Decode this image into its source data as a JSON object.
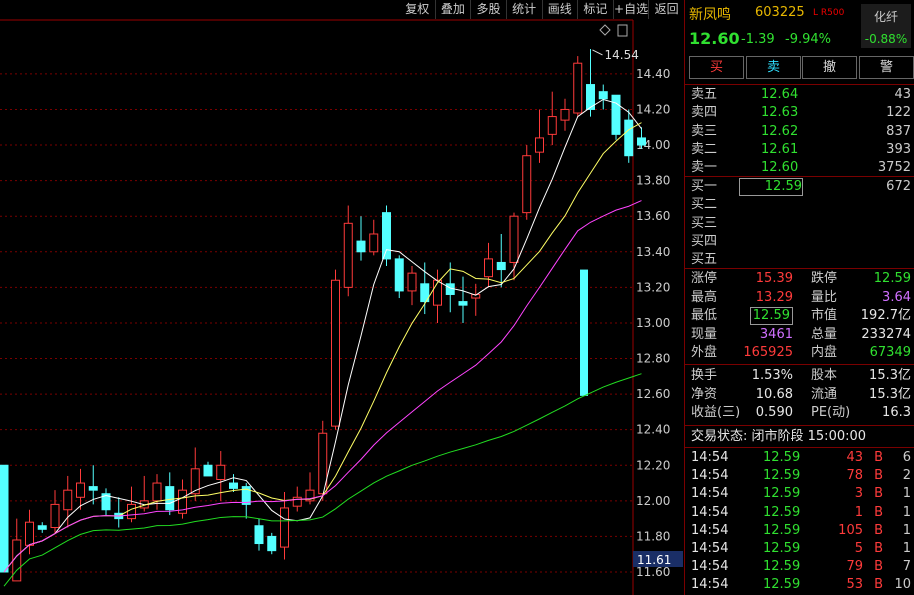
{
  "toolbar": [
    "复权",
    "叠加",
    "多股",
    "统计",
    "画线",
    "标记",
    "+自选",
    "返回"
  ],
  "chart": {
    "ylabels": [
      "14.40",
      "14.20",
      "14.00",
      "13.80",
      "13.60",
      "13.40",
      "13.20",
      "13.00",
      "12.80",
      "12.60",
      "12.40",
      "12.20",
      "12.00",
      "11.80",
      "11.60"
    ],
    "current_price_tag": "11.61",
    "high_label": "14.54",
    "colors": {
      "up": "#ff3b3b",
      "down": "#54ffff",
      "ma5": "#ffffff",
      "ma10": "#ffff66",
      "ma20": "#ff44ff",
      "ma60": "#22dd22",
      "grid": "#7a0000"
    }
  },
  "chart_data": {
    "type": "candlestick",
    "ylim": [
      11.55,
      14.6
    ],
    "y_ticks": [
      11.6,
      11.8,
      12.0,
      12.2,
      12.4,
      12.6,
      12.8,
      13.0,
      13.2,
      13.4,
      13.6,
      13.8,
      14.0,
      14.2,
      14.4
    ],
    "high_annotation": 14.54,
    "candles": [
      {
        "o": 12.2,
        "h": 12.2,
        "l": 11.6,
        "c": 11.6
      },
      {
        "o": 11.55,
        "h": 11.9,
        "l": 11.55,
        "c": 11.78
      },
      {
        "o": 11.75,
        "h": 11.95,
        "l": 11.7,
        "c": 11.88
      },
      {
        "o": 11.86,
        "h": 11.88,
        "l": 11.82,
        "c": 11.84
      },
      {
        "o": 11.85,
        "h": 12.06,
        "l": 11.82,
        "c": 11.98
      },
      {
        "o": 11.95,
        "h": 12.14,
        "l": 11.85,
        "c": 12.06
      },
      {
        "o": 12.02,
        "h": 12.18,
        "l": 11.95,
        "c": 12.1
      },
      {
        "o": 12.08,
        "h": 12.2,
        "l": 11.98,
        "c": 12.06
      },
      {
        "o": 12.04,
        "h": 12.07,
        "l": 11.92,
        "c": 11.95
      },
      {
        "o": 11.93,
        "h": 12.02,
        "l": 11.85,
        "c": 11.9
      },
      {
        "o": 11.9,
        "h": 12.08,
        "l": 11.88,
        "c": 11.98
      },
      {
        "o": 11.96,
        "h": 12.14,
        "l": 11.94,
        "c": 12.0
      },
      {
        "o": 12.0,
        "h": 12.15,
        "l": 11.95,
        "c": 12.1
      },
      {
        "o": 12.08,
        "h": 12.16,
        "l": 11.92,
        "c": 11.95
      },
      {
        "o": 11.93,
        "h": 12.12,
        "l": 11.9,
        "c": 12.06
      },
      {
        "o": 12.04,
        "h": 12.3,
        "l": 12.0,
        "c": 12.18
      },
      {
        "o": 12.2,
        "h": 12.22,
        "l": 12.14,
        "c": 12.14
      },
      {
        "o": 12.12,
        "h": 12.28,
        "l": 12.0,
        "c": 12.2
      },
      {
        "o": 12.1,
        "h": 12.15,
        "l": 12.05,
        "c": 12.07
      },
      {
        "o": 12.08,
        "h": 12.1,
        "l": 11.9,
        "c": 11.98
      },
      {
        "o": 11.86,
        "h": 11.9,
        "l": 11.72,
        "c": 11.76
      },
      {
        "o": 11.8,
        "h": 11.82,
        "l": 11.7,
        "c": 11.72
      },
      {
        "o": 11.74,
        "h": 12.05,
        "l": 11.67,
        "c": 11.96
      },
      {
        "o": 11.97,
        "h": 12.08,
        "l": 11.94,
        "c": 12.02
      },
      {
        "o": 12.0,
        "h": 12.16,
        "l": 11.98,
        "c": 12.06
      },
      {
        "o": 12.04,
        "h": 12.45,
        "l": 12.0,
        "c": 12.38
      },
      {
        "o": 12.42,
        "h": 13.3,
        "l": 12.4,
        "c": 13.24
      },
      {
        "o": 13.2,
        "h": 13.66,
        "l": 13.15,
        "c": 13.56
      },
      {
        "o": 13.46,
        "h": 13.6,
        "l": 13.35,
        "c": 13.4
      },
      {
        "o": 13.4,
        "h": 13.58,
        "l": 13.38,
        "c": 13.5
      },
      {
        "o": 13.62,
        "h": 13.66,
        "l": 13.32,
        "c": 13.36
      },
      {
        "o": 13.36,
        "h": 13.38,
        "l": 13.14,
        "c": 13.18
      },
      {
        "o": 13.18,
        "h": 13.32,
        "l": 13.1,
        "c": 13.28
      },
      {
        "o": 13.22,
        "h": 13.34,
        "l": 13.05,
        "c": 13.12
      },
      {
        "o": 13.1,
        "h": 13.3,
        "l": 13.0,
        "c": 13.24
      },
      {
        "o": 13.22,
        "h": 13.34,
        "l": 13.06,
        "c": 13.16
      },
      {
        "o": 13.12,
        "h": 13.26,
        "l": 13.0,
        "c": 13.1
      },
      {
        "o": 13.14,
        "h": 13.22,
        "l": 13.04,
        "c": 13.16
      },
      {
        "o": 13.26,
        "h": 13.45,
        "l": 13.2,
        "c": 13.36
      },
      {
        "o": 13.34,
        "h": 13.5,
        "l": 13.2,
        "c": 13.3
      },
      {
        "o": 13.34,
        "h": 13.62,
        "l": 13.24,
        "c": 13.6
      },
      {
        "o": 13.62,
        "h": 14.0,
        "l": 13.58,
        "c": 13.94
      },
      {
        "o": 13.96,
        "h": 14.2,
        "l": 13.9,
        "c": 14.04
      },
      {
        "o": 14.06,
        "h": 14.3,
        "l": 14.0,
        "c": 14.16
      },
      {
        "o": 14.14,
        "h": 14.26,
        "l": 14.08,
        "c": 14.2
      },
      {
        "o": 14.18,
        "h": 14.5,
        "l": 14.16,
        "c": 14.46
      },
      {
        "o": 14.34,
        "h": 14.54,
        "l": 14.16,
        "c": 14.2
      },
      {
        "o": 14.3,
        "h": 14.34,
        "l": 14.2,
        "c": 14.26
      },
      {
        "o": 14.28,
        "h": 14.28,
        "l": 14.03,
        "c": 14.06
      },
      {
        "o": 14.14,
        "h": 14.2,
        "l": 13.9,
        "c": 13.94
      },
      {
        "o": 14.04,
        "h": 14.1,
        "l": 13.98,
        "c": 14.0
      }
    ],
    "volume_bar": {
      "top": 13.3,
      "bottom": 12.59
    }
  },
  "panel": {
    "name": "新凤鸣",
    "code": "603225",
    "lr": "L R500",
    "price": "12.60",
    "change": "-1.39",
    "change_pct": "-9.94%",
    "sector": {
      "name": "化纤",
      "pct": "-0.88%"
    },
    "buttons": [
      {
        "label": "买",
        "color": "#ff3b3b"
      },
      {
        "label": "卖",
        "color": "#30e0ff"
      },
      {
        "label": "撤",
        "color": "#dddddd"
      },
      {
        "label": "警",
        "color": "#dddddd"
      }
    ],
    "asks": [
      {
        "label": "卖五",
        "price": "12.64",
        "vol": "43"
      },
      {
        "label": "卖四",
        "price": "12.63",
        "vol": "122"
      },
      {
        "label": "卖三",
        "price": "12.62",
        "vol": "837"
      },
      {
        "label": "卖二",
        "price": "12.61",
        "vol": "393"
      },
      {
        "label": "卖一",
        "price": "12.60",
        "vol": "3752"
      }
    ],
    "bids": [
      {
        "label": "买一",
        "price": "12.59",
        "vol": "672"
      },
      {
        "label": "买二",
        "price": "",
        "vol": ""
      },
      {
        "label": "买三",
        "price": "",
        "vol": ""
      },
      {
        "label": "买四",
        "price": "",
        "vol": ""
      },
      {
        "label": "买五",
        "price": "",
        "vol": ""
      }
    ],
    "stats": [
      {
        "l1": "涨停",
        "v1": "15.39",
        "c1": "red",
        "l2": "跌停",
        "v2": "12.59",
        "c2": "green"
      },
      {
        "l1": "最高",
        "v1": "13.29",
        "c1": "red",
        "l2": "量比",
        "v2": "3.64",
        "c2": "mag"
      },
      {
        "l1": "最低",
        "v1": "12.59",
        "c1": "green",
        "l2": "市值",
        "v2": "192.7亿",
        "c2": "white"
      },
      {
        "l1": "现量",
        "v1": "3461",
        "c1": "mag",
        "l2": "总量",
        "v2": "233274",
        "c2": "white"
      },
      {
        "l1": "外盘",
        "v1": "165925",
        "c1": "red",
        "l2": "内盘",
        "v2": "67349",
        "c2": "green"
      }
    ],
    "fin": [
      {
        "l1": "换手",
        "v1": "1.53%",
        "l2": "股本",
        "v2": "15.3亿"
      },
      {
        "l1": "净资",
        "v1": "10.68",
        "l2": "流通",
        "v2": "15.3亿"
      },
      {
        "l1": "收益(三)",
        "v1": "0.590",
        "l2": "PE(动)",
        "v2": "16.3"
      }
    ],
    "trade_status": "交易状态: 闭市阶段 15:00:00",
    "ticks": [
      {
        "time": "14:54",
        "price": "12.59",
        "vol": "43",
        "side": "B",
        "n": "6"
      },
      {
        "time": "14:54",
        "price": "12.59",
        "vol": "78",
        "side": "B",
        "n": "2"
      },
      {
        "time": "14:54",
        "price": "12.59",
        "vol": "3",
        "side": "B",
        "n": "1"
      },
      {
        "time": "14:54",
        "price": "12.59",
        "vol": "1",
        "side": "B",
        "n": "1"
      },
      {
        "time": "14:54",
        "price": "12.59",
        "vol": "105",
        "side": "B",
        "n": "1"
      },
      {
        "time": "14:54",
        "price": "12.59",
        "vol": "5",
        "side": "B",
        "n": "1"
      },
      {
        "time": "14:54",
        "price": "12.59",
        "vol": "79",
        "side": "B",
        "n": "7"
      },
      {
        "time": "14:54",
        "price": "12.59",
        "vol": "53",
        "side": "B",
        "n": "10"
      }
    ]
  }
}
